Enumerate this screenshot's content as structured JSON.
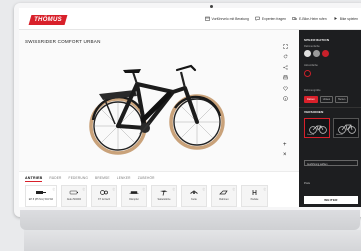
{
  "brand": {
    "logo_text": "THÖMUS",
    "accent": "#d8202a"
  },
  "header": {
    "nav": [
      {
        "label": "Vorführvelo mit Beratung",
        "icon": "calendar-icon"
      },
      {
        "label": "Experten fragen",
        "icon": "chat-icon"
      },
      {
        "label": "E-Bike-Heim rufen",
        "icon": "truck-icon"
      },
      {
        "label": "Bike spielen",
        "icon": "play-icon"
      }
    ]
  },
  "product": {
    "title": "SWISSRIDER COMFORT URBAN"
  },
  "toolbar": {
    "zoom_in": "+",
    "zoom_out": "×"
  },
  "tabs": [
    "ANTRIEB",
    "RÄDER",
    "FEDERUNG",
    "BREMSE",
    "LENKER",
    "ZUBEHÖR"
  ],
  "components": [
    {
      "label": "EP 8 (85 Nm) 504 Wh",
      "icon": "motor-icon"
    },
    {
      "label": "Akku 504Wh",
      "icon": "battery-icon"
    },
    {
      "label": "XT 12-fach",
      "icon": "gears-icon"
    },
    {
      "label": "Dämpfer",
      "icon": "shock-icon"
    },
    {
      "label": "Sattelstütze",
      "icon": "seatpost-icon"
    },
    {
      "label": "Kette",
      "icon": "chain-icon"
    },
    {
      "label": "Rahmen",
      "icon": "frame-icon"
    },
    {
      "label": "Pedale",
      "icon": "pedal-icon"
    }
  ],
  "panel": {
    "spec_heading": "SPEZIFIKATION",
    "color_label": "Rahmenfarbe",
    "colors": [
      "#e0e0e0",
      "#9a9a9a",
      "#c8202a"
    ],
    "accent_label": "Akzentfarbe",
    "accent_color": "#c8202a",
    "size_label": "Rahmengröße",
    "sizes": [
      "Damen",
      "Unisex",
      "Herren"
    ],
    "selected_size": "Damen",
    "variant_heading": "VERSIONEN",
    "variants": [
      {
        "label": "Damen",
        "selected": true
      },
      {
        "label": "Herren",
        "selected": false
      }
    ],
    "select_value": "Ausführung wählen",
    "price_label": "Preis",
    "price_value": "",
    "next_button": "WEITER"
  }
}
